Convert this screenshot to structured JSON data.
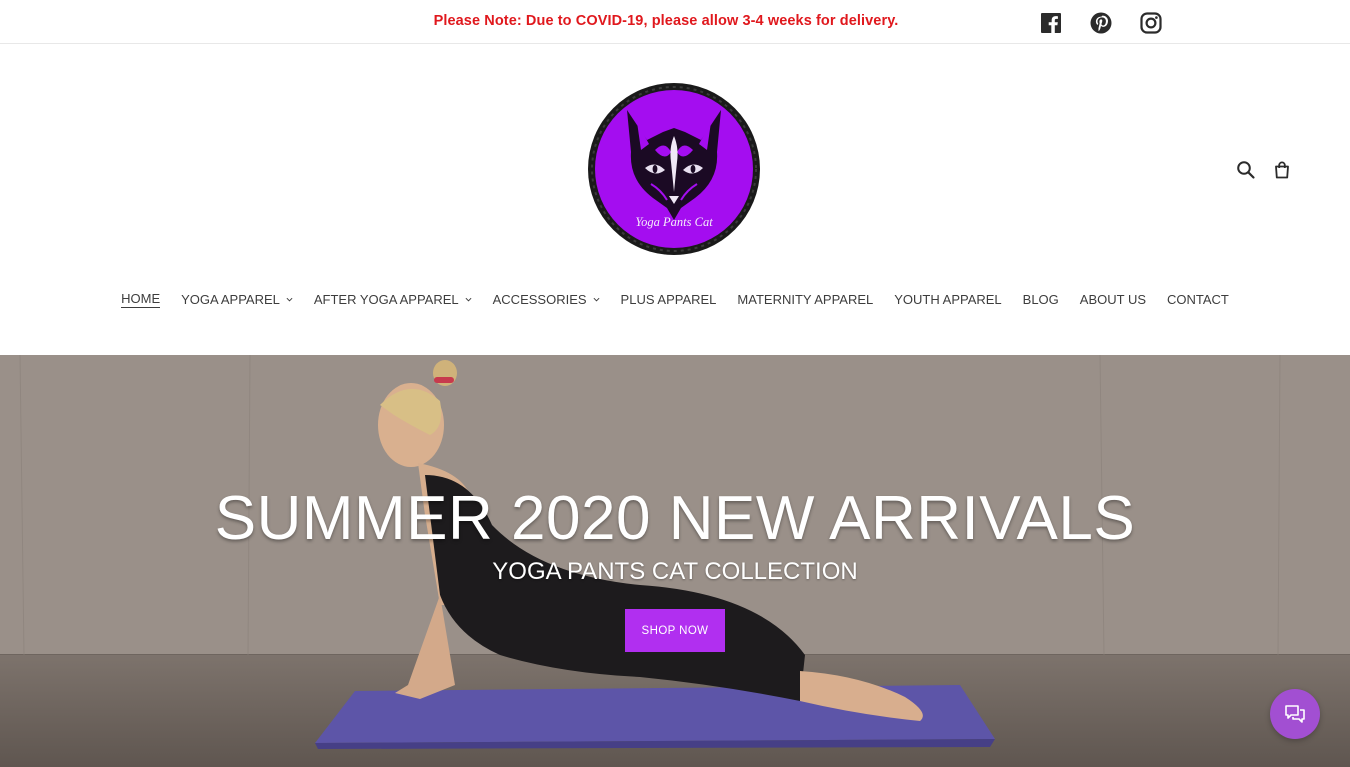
{
  "announcement": {
    "text": "Please Note: Due to COVID-19, please allow 3-4 weeks for delivery."
  },
  "social": [
    {
      "icon": "facebook-icon"
    },
    {
      "icon": "pinterest-icon"
    },
    {
      "icon": "instagram-icon"
    }
  ],
  "logo": {
    "text": "Yoga Pants Cat",
    "color": "#a40df0"
  },
  "header_icons": [
    "search-icon",
    "cart-icon"
  ],
  "nav": {
    "items": [
      {
        "label": "HOME",
        "active": true,
        "dropdown": false
      },
      {
        "label": "YOGA APPAREL",
        "dropdown": true
      },
      {
        "label": "AFTER YOGA APPAREL",
        "dropdown": true
      },
      {
        "label": "ACCESSORIES",
        "dropdown": true
      },
      {
        "label": "PLUS APPAREL",
        "dropdown": false
      },
      {
        "label": "MATERNITY APPAREL",
        "dropdown": false
      },
      {
        "label": "YOUTH APPAREL",
        "dropdown": false
      },
      {
        "label": "BLOG",
        "dropdown": false
      },
      {
        "label": "ABOUT US",
        "dropdown": false
      },
      {
        "label": "CONTACT",
        "dropdown": false
      }
    ]
  },
  "hero": {
    "title": "SUMMER 2020 NEW ARRIVALS",
    "subtitle": "YOGA PANTS CAT COLLECTION",
    "button_label": "SHOP NOW"
  },
  "colors": {
    "accent": "#b12ff0",
    "announcement": "#e0181d",
    "chat": "#a24fd2"
  }
}
